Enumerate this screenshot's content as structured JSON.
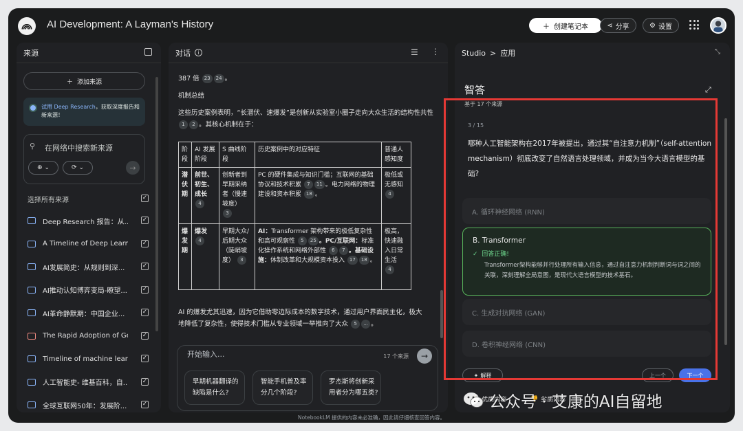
{
  "app": {
    "title": "AI Development: A Layman's History",
    "create_notebook": "创建笔记本",
    "share": "分享",
    "settings": "设置"
  },
  "sources": {
    "header": "来源",
    "add_source": "添加来源",
    "promo_link": "试用 Deep Research",
    "promo_text": "，获取深度报告和新来源！",
    "search_placeholder": "在网络中搜索新来源",
    "select_all": "选择所有来源",
    "items": [
      {
        "label": "Deep Research 报告：从...",
        "icon": "report-icon",
        "color": "#8ab4f8"
      },
      {
        "label": "A Timeline of Deep Learni...",
        "icon": "web-icon",
        "color": "#8ab4f8"
      },
      {
        "label": "AI发展简史：从规则到深...",
        "icon": "doc-icon",
        "color": "#8ab4f8"
      },
      {
        "label": "AI推动认知博弈变局-瞭望...",
        "icon": "web-icon",
        "color": "#8ab4f8"
      },
      {
        "label": "AI革命静默期：中国企业...",
        "icon": "web-icon",
        "color": "#8ab4f8"
      },
      {
        "label": "The Rapid Adoption of Ge...",
        "icon": "pdf-icon",
        "color": "#f28b82"
      },
      {
        "label": "Timeline of machine learn...",
        "icon": "web-icon",
        "color": "#8ab4f8"
      },
      {
        "label": "人工智能史- 维基百科，自...",
        "icon": "web-icon",
        "color": "#8ab4f8"
      },
      {
        "label": "全球互联网50年：发展阶...",
        "icon": "web-icon",
        "color": "#8ab4f8"
      }
    ]
  },
  "chat": {
    "header": "对话",
    "line1_text": "387 倍",
    "line1_cites": [
      "23",
      "24"
    ],
    "heading": "机制总结",
    "intro": "这些历史案例表明，“长潜伏、速爆发”是创新从实验室小圈子走向大众生活的结构性共性",
    "intro_cites": [
      "1",
      "2"
    ],
    "intro_end": "。其核心机制在于：",
    "table": {
      "headers": [
        "阶段",
        "AI 发展阶段",
        "S 曲线阶段",
        "历史案例中的对应特征",
        "普通人感知度"
      ],
      "row1": {
        "stage": "潜伏期",
        "ai": "前世、初生、成长",
        "ai_cite": "4",
        "s": "创新者到早期采纳者（慢速坡度）",
        "s_cite": "3",
        "hist": "PC 的硬件集成与知识门槛；互联网的基础协议和技术积累",
        "hist_cites": [
          "7",
          "11"
        ],
        "hist2": "。电力网络的物理建设和资本积累",
        "hist2_cite": "18",
        "perc": "极低或无感知",
        "perc_cite": "4"
      },
      "row2": {
        "stage": "爆发期",
        "ai": "爆发",
        "ai_cite": "4",
        "s": "早期大众/后期大众（陡峭坡度）",
        "s_cite": "3",
        "hist_a_label": "AI：",
        "hist_a": "Transformer 架构带来的极低复杂性和高可观察性",
        "hist_a_cites": [
          "5",
          "25"
        ],
        "hist_b_label": "。PC/互联网：",
        "hist_b": "标准化操作系统和网络外部性",
        "hist_b_cites": [
          "6",
          "7"
        ],
        "hist_c_label": "。基础设施：",
        "hist_c": "体制改革和大规模资本投入",
        "hist_c_cites": [
          "17",
          "18"
        ],
        "perc": "极高，快速融入日常生活",
        "perc_cite": "4"
      }
    },
    "after": "AI 的爆发尤其迅速，因为它借助零边际成本的数字技术，通过用户界面民主化，极大地降低了复杂性，使得技术门槛从专业领域一举推向了大众",
    "after_cites": [
      "5",
      "..."
    ],
    "input_placeholder": "开始输入...",
    "source_count": "17 个来源",
    "suggestions": [
      "早期机器翻译的缺陷是什么?",
      "智能手机普及率分几个阶段?",
      "罗杰斯将创新采用者分为哪五类?"
    ]
  },
  "studio": {
    "breadcrumb_root": "Studio",
    "breadcrumb_sep": ">",
    "breadcrumb_current": "应用",
    "title": "智答",
    "subtitle": "基于 17 个来源",
    "counter": "3 / 15",
    "question": "哪种人工智能架构在2017年被提出，通过其“自注意力机制”（self-attention mechanism）彻底改变了自然语言处理领域，并成为当今大语言模型的基础?",
    "options": [
      {
        "label": "A. 循环神经网络 (RNN)"
      },
      {
        "label": "B. Transformer"
      },
      {
        "label": "C. 生成对抗网络 (GAN)"
      },
      {
        "label": "D. 卷积神经网络 (CNN)"
      }
    ],
    "correct_text": "回答正确!",
    "explanation": "Transformer架构能够并行处理所有输入信息，通过自注意力机制判断词与词之间的关联，深刻理解全局意图，是现代大语言模型的技术基石。",
    "explain_btn": "解释",
    "prev_btn": "上一个",
    "next_btn": "下一个",
    "good_content": "优质内容",
    "bad_content": "劣质内容"
  },
  "footer": {
    "disclaimer": "NotebookLM 提供的内容未必准确，因此请仔细核查回答内容。"
  },
  "watermark": {
    "text": "公众号 · 艾康的AI自留地"
  },
  "colors": {
    "background": "#1b1c1d",
    "panel": "#202124",
    "accent_blue": "#4a72e8",
    "correct_green": "#57b35a",
    "highlight_red": "#e53935"
  }
}
